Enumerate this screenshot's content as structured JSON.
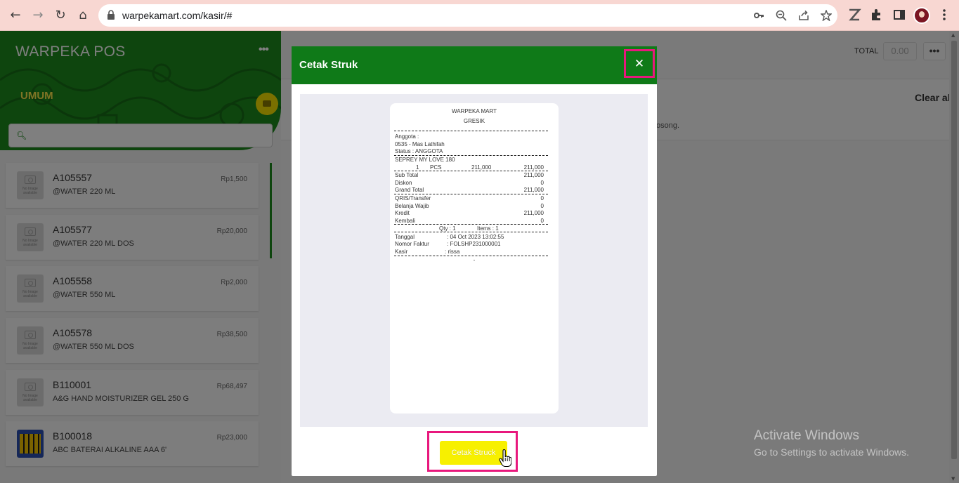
{
  "browser": {
    "url": "warpekamart.com/kasir/#",
    "back": "←",
    "forward": "→",
    "reload": "↻",
    "home": "⌂"
  },
  "sidebar": {
    "brand": "WARPEKA POS",
    "menu_dots": "•••",
    "category": "UMUM",
    "search_placeholder": "",
    "no_image_text": "No Image available",
    "products": [
      {
        "code": "A105557",
        "name": "@WATER 220 ML",
        "price": "Rp1,500",
        "image": "placeholder"
      },
      {
        "code": "A105577",
        "name": "@WATER 220 ML DOS",
        "price": "Rp20,000",
        "image": "placeholder"
      },
      {
        "code": "A105558",
        "name": "@WATER 550 ML",
        "price": "Rp2,000",
        "image": "placeholder"
      },
      {
        "code": "A105578",
        "name": "@WATER 550 ML DOS",
        "price": "Rp38,500",
        "image": "placeholder"
      },
      {
        "code": "B110001",
        "name": "A&G HAND MOISTURIZER GEL 250 G",
        "price": "Rp68,497",
        "image": "placeholder"
      },
      {
        "code": "B100018",
        "name": "ABC BATERAI ALKALINE AAA 6'",
        "price": "Rp23,000",
        "image": "battery"
      }
    ]
  },
  "cart": {
    "total_label": "TOTAL",
    "total_value": "0.00",
    "more": "•••",
    "clear_all": "Clear all",
    "empty_message": "osong."
  },
  "modal": {
    "title": "Cetak Struk",
    "close": "✕",
    "print_button": "Cetak Struck"
  },
  "receipt": {
    "store": "WARPEKA MART",
    "city": "GRESIK",
    "member_label": "Anggota :",
    "member": "0535 - Mas Lathifah",
    "status": "Status : ANGGOTA",
    "item_name": "SEPREY MY LOVE 180",
    "item_qty": "1",
    "item_unit": "PCS",
    "item_price": "211,000",
    "item_total": "211,000",
    "subtotal_label": "Sub Total",
    "subtotal": "211,000",
    "diskon_label": "Diskon",
    "diskon": "0",
    "grand_label": "Grand Total",
    "grand": "211,000",
    "qris_label": "QRIS/Transfer",
    "qris": "0",
    "wajib_label": "Belanja Wajib",
    "wajib": "0",
    "kredit_label": "Kredit",
    "kredit": "211,000",
    "kembali_label": "Kembali",
    "kembali": "0",
    "qty_summary": "Qty : 1",
    "items_summary": "Items : 1",
    "tanggal_label": "Tanggal",
    "tanggal": ": 04 Oct 2023 13:02:55",
    "faktur_label": "Nomor Faktur",
    "faktur": ": FOLSHP231000001",
    "kasir_label": "Kasir",
    "kasir": ": rissa",
    "footer_mark": "-"
  },
  "watermark": {
    "line1": "Activate Windows",
    "line2": "Go to Settings to activate Windows."
  },
  "colors": {
    "brand_green": "#1c8a1c",
    "modal_green": "#0f7a18",
    "highlight": "#e8187d",
    "print_yellow": "#f7f000"
  }
}
